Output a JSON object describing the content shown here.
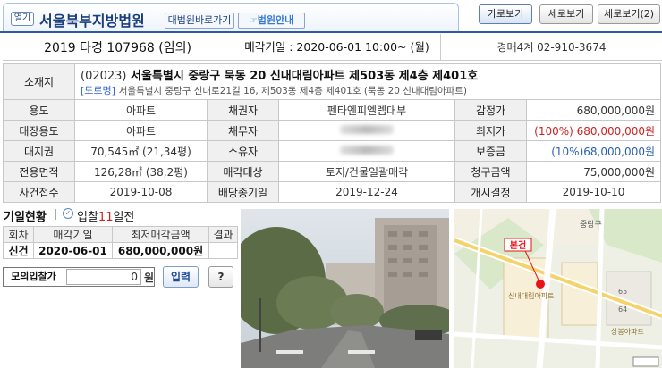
{
  "header": {
    "open_label": "열기",
    "court_name": "서울북부지방법원",
    "court_link": "대법원바로가기",
    "guide_link": "법원안내",
    "view_horizontal": "가로보기",
    "view_vertical": "세로보기",
    "view_vertical2": "세로보기(2)"
  },
  "case": {
    "number": "2019 타경 107968 (임의)",
    "sale_date": "매각기일 : 2020-06-01 10:00~ (월)",
    "dept": "경매4계 02-910-3674"
  },
  "address": {
    "label": "소재지",
    "zip": "(02023)",
    "main": "서울특별시 중랑구 묵동 20 신내대림아파트 제503동 제4층 제401호",
    "road_tag": "[도로명]",
    "road": "서울특별시 중랑구 신내로21길 16, 제503동 제4층 제401호 (묵동 20 신내대림아파트)"
  },
  "rows": [
    {
      "l1": "용도",
      "v1": "아파트",
      "l2": "채권자",
      "v2": "펜타엔피엘렙대부",
      "l3": "감정가",
      "v3": "680,000,000원"
    },
    {
      "l1": "대장용도",
      "v1": "아파트",
      "l2": "채무자",
      "v2": "",
      "l3": "최저가",
      "v3": "(100%) 680,000,000원"
    },
    {
      "l1": "대지권",
      "v1": "70,545㎡ (21,34평)",
      "l2": "소유자",
      "v2": "",
      "l3": "보증금",
      "v3": "(10%)68,000,000원"
    },
    {
      "l1": "전용면적",
      "v1": "126,28㎡ (38,2평)",
      "l2": "매각대상",
      "v2": "토지/건물일괄매각",
      "l3": "청구금액",
      "v3": "75,000,000원"
    },
    {
      "l1": "사건접수",
      "v1": "2019-10-08",
      "l2": "배당종기일",
      "v2": "2019-12-24",
      "l3": "개시결정",
      "v3": "2019-10-10"
    }
  ],
  "bid": {
    "title": "기일현황",
    "days_prefix": "입찰",
    "days_num": "11",
    "days_suffix": "일전"
  },
  "history": {
    "headers": [
      "회차",
      "매각기일",
      "최저매각금액",
      "결과"
    ],
    "row": [
      "신건",
      "2020-06-01",
      "680,000,000원",
      ""
    ]
  },
  "mock": {
    "label": "모의입찰가",
    "value": "0",
    "unit": "원",
    "enter": "입력",
    "help": "?"
  },
  "map": {
    "marker_label": "본건",
    "labels": [
      "신내대림아파트",
      "중랑구",
      "65",
      "64",
      "상봉아파트"
    ]
  },
  "colors": {
    "accent": "#2c5aa0",
    "red": "#d02020",
    "blue": "#2a5fb0"
  }
}
